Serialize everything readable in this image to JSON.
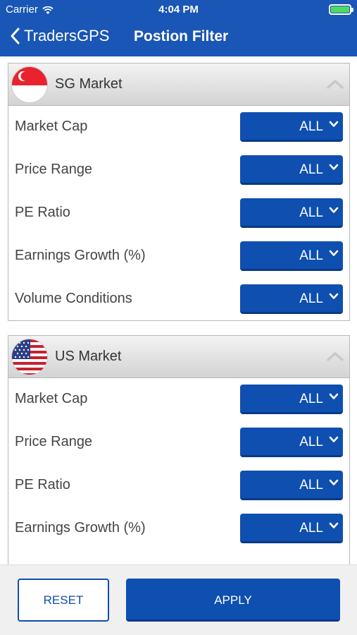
{
  "status": {
    "carrier": "Carrier",
    "time": "4:04 PM"
  },
  "nav": {
    "back_label": "TradersGPS",
    "title": "Postion Filter"
  },
  "sg": {
    "title": "SG Market",
    "rows": [
      {
        "label": "Market Cap",
        "value": "ALL"
      },
      {
        "label": "Price Range",
        "value": "ALL"
      },
      {
        "label": "PE Ratio",
        "value": "ALL"
      },
      {
        "label": "Earnings Growth (%)",
        "value": "ALL"
      },
      {
        "label": "Volume Conditions",
        "value": "ALL"
      }
    ]
  },
  "us": {
    "title": "US Market",
    "rows": [
      {
        "label": "Market Cap",
        "value": "ALL"
      },
      {
        "label": "Price Range",
        "value": "ALL"
      },
      {
        "label": "PE Ratio",
        "value": "ALL"
      },
      {
        "label": "Earnings Growth (%)",
        "value": "ALL"
      }
    ]
  },
  "buttons": {
    "reset": "RESET",
    "apply": "APPLY"
  },
  "colors": {
    "brand": "#1a56b6",
    "button": "#0e4fb0",
    "battery": "#4cd964"
  },
  "icons": [
    "wifi-icon",
    "battery-icon",
    "back-chevron-icon",
    "sg-flag-icon",
    "us-flag-icon",
    "collapse-chevron-icon",
    "dropdown-chevron-icon"
  ]
}
